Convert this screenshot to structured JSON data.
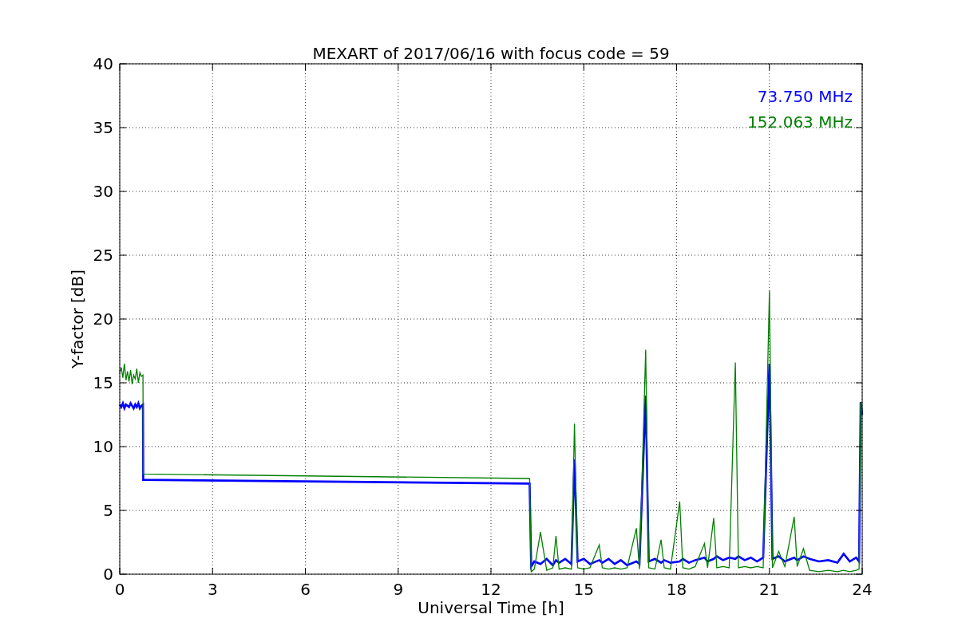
{
  "chart_data": {
    "type": "line",
    "title": "MEXART of 2017/06/16 with focus code = 59",
    "xlabel": "Universal Time [h]",
    "ylabel": "Y-factor [dB]",
    "x": [
      0,
      0.05,
      0.1,
      0.15,
      0.2,
      0.25,
      0.3,
      0.35,
      0.4,
      0.45,
      0.5,
      0.55,
      0.6,
      0.65,
      0.7,
      0.75,
      0.76,
      13.25,
      13.3,
      13.4,
      13.6,
      13.8,
      14.0,
      14.1,
      14.2,
      14.4,
      14.6,
      14.7,
      14.8,
      15.0,
      15.2,
      15.5,
      15.6,
      15.8,
      16.0,
      16.2,
      16.4,
      16.7,
      16.8,
      17.0,
      17.1,
      17.3,
      17.5,
      17.6,
      17.8,
      18.1,
      18.2,
      18.4,
      18.6,
      18.9,
      19.0,
      19.2,
      19.3,
      19.5,
      19.7,
      19.9,
      20.0,
      20.2,
      20.4,
      20.6,
      20.8,
      21.0,
      21.1,
      21.3,
      21.5,
      21.8,
      21.9,
      22.1,
      22.3,
      22.6,
      22.9,
      23.2,
      23.4,
      23.6,
      23.8,
      23.9,
      23.95,
      24.0
    ],
    "series": [
      {
        "name": "73.750 MHz",
        "color": "#0000ff",
        "values": [
          13.3,
          13.1,
          13.4,
          13.0,
          13.3,
          13.2,
          13.1,
          13.4,
          13.2,
          13.0,
          13.3,
          13.1,
          13.4,
          13.0,
          13.2,
          13.3,
          7.4,
          7.1,
          0.6,
          1.0,
          0.8,
          1.2,
          0.7,
          1.1,
          0.9,
          1.2,
          0.8,
          9.0,
          1.0,
          1.2,
          0.8,
          1.1,
          0.9,
          1.2,
          0.8,
          1.1,
          0.7,
          1.0,
          0.8,
          14.0,
          1.0,
          1.2,
          0.9,
          1.1,
          0.9,
          1.0,
          1.2,
          0.9,
          1.1,
          1.3,
          1.0,
          1.2,
          1.4,
          1.1,
          1.3,
          1.2,
          1.4,
          1.1,
          1.3,
          1.0,
          1.3,
          16.5,
          1.2,
          1.4,
          1.0,
          1.3,
          1.1,
          1.4,
          1.2,
          1.0,
          1.1,
          0.9,
          1.6,
          1.0,
          1.3,
          1.0,
          13.5,
          12.5
        ]
      },
      {
        "name": "152.063 MHz",
        "color": "#008000",
        "values": [
          15.8,
          16.2,
          15.4,
          16.5,
          15.2,
          15.9,
          15.1,
          16.0,
          14.9,
          15.6,
          15.3,
          16.1,
          15.0,
          15.8,
          15.5,
          15.6,
          7.85,
          7.5,
          0.2,
          0.4,
          3.3,
          0.3,
          0.5,
          3.0,
          0.4,
          0.5,
          0.4,
          11.8,
          0.5,
          0.4,
          0.5,
          2.3,
          0.5,
          0.4,
          0.5,
          0.4,
          0.5,
          3.6,
          0.4,
          17.6,
          0.5,
          0.4,
          2.7,
          0.5,
          0.4,
          5.7,
          0.5,
          0.4,
          0.6,
          2.4,
          0.5,
          4.4,
          0.5,
          0.6,
          0.5,
          16.6,
          0.5,
          0.6,
          0.5,
          0.6,
          0.5,
          22.2,
          0.5,
          1.8,
          0.6,
          4.5,
          0.6,
          2.0,
          0.3,
          0.2,
          0.3,
          0.2,
          0.3,
          0.2,
          0.3,
          0.4,
          13.5,
          12.5
        ]
      }
    ],
    "grid": true,
    "xlim": [
      0,
      24
    ],
    "ylim": [
      0,
      40
    ],
    "xticks": [
      0,
      3,
      6,
      9,
      12,
      15,
      18,
      21,
      24
    ],
    "yticks": [
      0,
      5,
      10,
      15,
      20,
      25,
      30,
      35,
      40
    ]
  }
}
